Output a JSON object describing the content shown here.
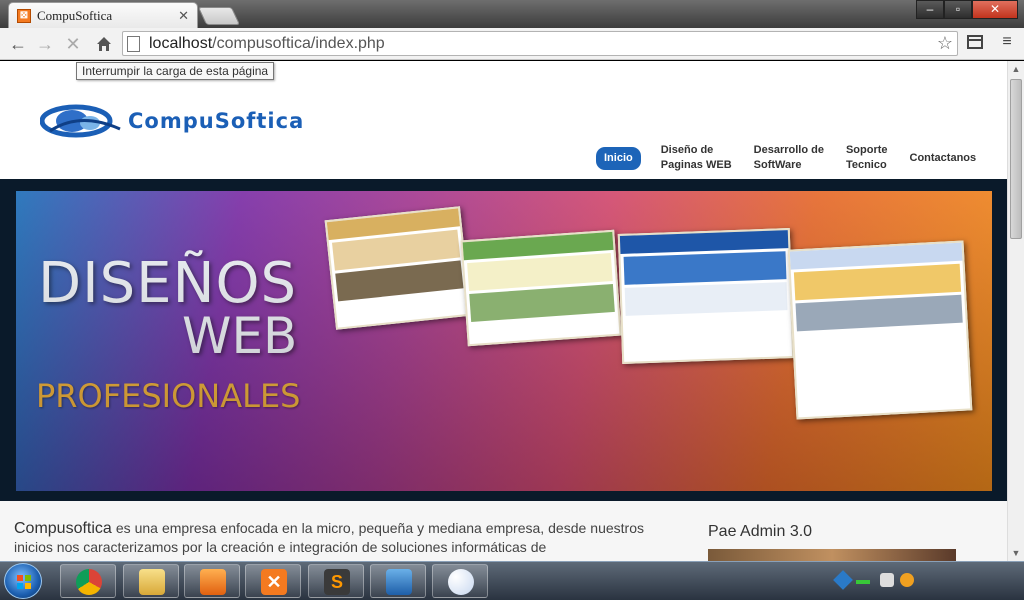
{
  "browser": {
    "tab_title": "CompuSoftica",
    "tab_favicon": "xampp-icon",
    "url_path": "localhost",
    "url_rest": "/compusoftica/index.php",
    "tooltip": "Interrumpir la carga de esta página"
  },
  "site": {
    "logo_text": "CompuSoftica",
    "nav": [
      {
        "label": "Inicio",
        "active": true
      },
      {
        "line1": "Diseño de",
        "line2": "Paginas WEB"
      },
      {
        "line1": "Desarrollo de",
        "line2": "SoftWare"
      },
      {
        "line1": "Soporte",
        "line2": "Tecnico"
      },
      {
        "label": "Contactanos"
      }
    ],
    "hero": {
      "line1": "DISEÑOS",
      "line2": "WEB",
      "line3": "PROFESIONALES"
    },
    "intro": {
      "brand": "Compusoftica",
      "text": " es una empresa enfocada en la micro, pequeña y mediana empresa, desde nuestros inicios nos caracterizamos por la creación e integración de soluciones informáticas de"
    },
    "sidebar_title": "Pae Admin 3.0"
  },
  "taskbar": {
    "apps": [
      "chrome-icon",
      "explorer-icon",
      "media-player-icon",
      "xampp-icon",
      "sublime-text-icon",
      "control-panel-icon",
      "paint-icon"
    ]
  },
  "colors": {
    "brand_blue": "#1b5fb6",
    "nav_active": "#1d64b8",
    "hero_orange": "#f6b53a"
  }
}
